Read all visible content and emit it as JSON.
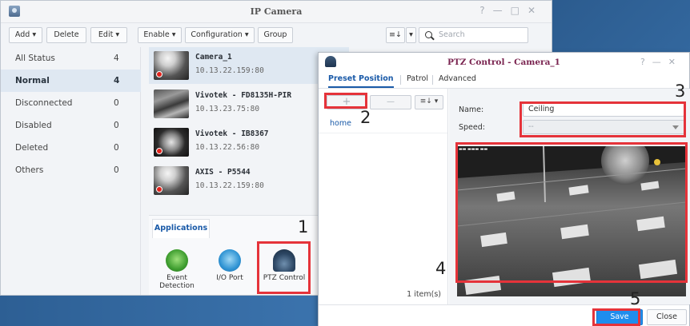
{
  "main_window": {
    "title": "IP Camera",
    "toolbar": {
      "add": "Add ▾",
      "delete": "Delete",
      "edit": "Edit ▾",
      "enable": "Enable ▾",
      "configuration": "Configuration ▾",
      "group": "Group",
      "sort": "≡↓",
      "sort_caret": "▾",
      "search_placeholder": "Search"
    },
    "sidebar": [
      {
        "label": "All Status",
        "count": "4"
      },
      {
        "label": "Normal",
        "count": "4"
      },
      {
        "label": "Disconnected",
        "count": "0"
      },
      {
        "label": "Disabled",
        "count": "0"
      },
      {
        "label": "Deleted",
        "count": "0"
      },
      {
        "label": "Others",
        "count": "0"
      }
    ],
    "cameras": [
      {
        "name": "Camera_1",
        "ip": "10.13.22.159:80"
      },
      {
        "name": "Vivotek - FD8135H-PIR",
        "ip": "10.13.23.75:80"
      },
      {
        "name": "Vivotek - IB8367",
        "ip": "10.13.22.56:80"
      },
      {
        "name": "AXIS - P5544",
        "ip": "10.13.22.159:80"
      }
    ],
    "applications": {
      "tab": "Applications",
      "items": [
        {
          "label": "Event Detection"
        },
        {
          "label": "I/O Port"
        },
        {
          "label": "PTZ Control"
        }
      ]
    }
  },
  "ptz_dialog": {
    "title": "PTZ Control - Camera_1",
    "tabs": [
      "Preset Position",
      "Patrol",
      "Advanced"
    ],
    "add_label": "+",
    "remove_label": "—",
    "sort_label": "≡↓ ▾",
    "presets": [
      "home"
    ],
    "item_count": "1 item(s)",
    "name_label": "Name:",
    "name_value": "Ceiling",
    "speed_label": "Speed:",
    "speed_value": "--",
    "save": "Save",
    "close": "Close"
  },
  "annotations": [
    "1",
    "2",
    "3",
    "4",
    "5"
  ],
  "colors": {
    "accent": "#1f8ded",
    "highlight_box": "#e5333a",
    "selection": "#dfe8f2",
    "ptz_title": "#7a2450"
  }
}
